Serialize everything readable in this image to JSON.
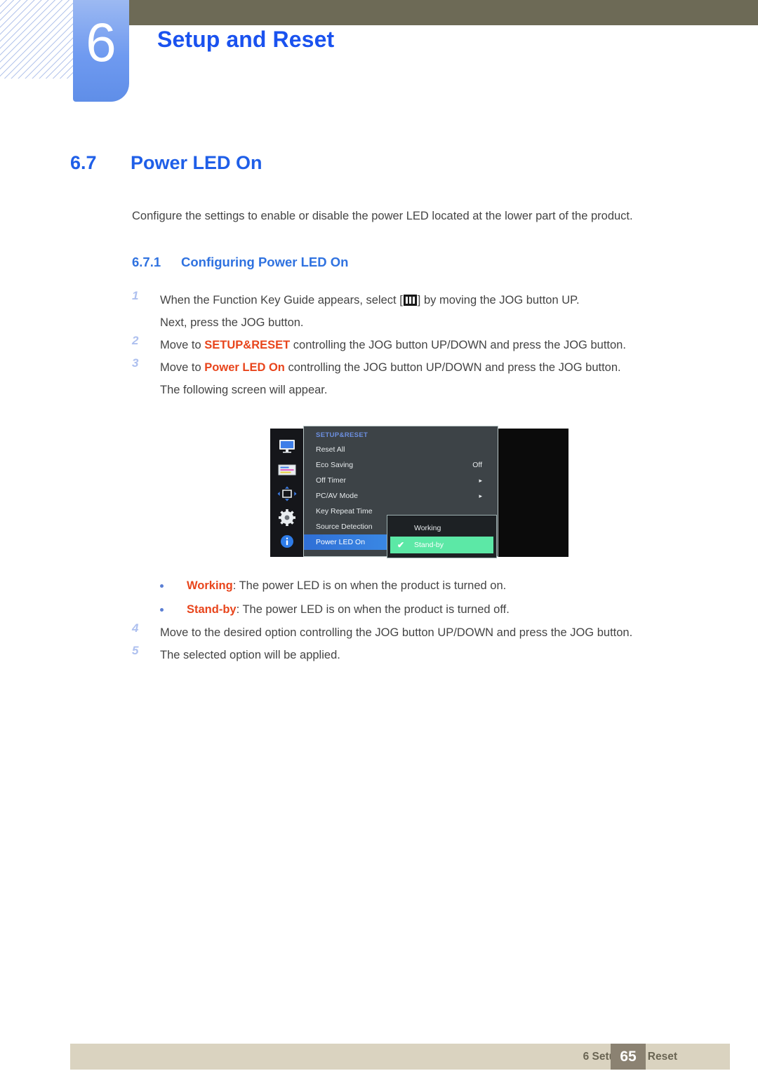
{
  "chapter": {
    "number": "6",
    "title": "Setup and Reset"
  },
  "section": {
    "number": "6.7",
    "title": "Power LED On",
    "intro": "Configure the settings to enable or disable the power LED located at the lower part of the product."
  },
  "subsection": {
    "number": "6.7.1",
    "title": "Configuring Power LED On"
  },
  "steps": [
    {
      "num": "1",
      "pre": "When the Function Key Guide appears, select [",
      "post": "] by moving the JOG button UP.",
      "line2": "Next, press the JOG button.",
      "icon": "osd-menu-icon"
    },
    {
      "num": "2",
      "pre": "Move to ",
      "highlight": "SETUP&RESET",
      "post": " controlling the JOG button UP/DOWN and press the JOG button."
    },
    {
      "num": "3",
      "pre": "Move to ",
      "highlight": "Power LED On",
      "post": " controlling the JOG button UP/DOWN and press the JOG button.",
      "line2": "The following screen will appear."
    }
  ],
  "steps_after": [
    {
      "num": "4",
      "text": "Move to the desired option controlling the JOG button UP/DOWN and press the JOG button."
    },
    {
      "num": "5",
      "text": "The selected option will be applied."
    }
  ],
  "osd": {
    "heading": "SETUP&RESET",
    "rail_icons": [
      "monitor-icon",
      "picture-settings-icon",
      "screen-adjust-icon",
      "gear-icon",
      "info-icon"
    ],
    "rows": [
      {
        "label": "Reset All",
        "value": "",
        "arrow": ""
      },
      {
        "label": "Eco Saving",
        "value": "Off",
        "arrow": ""
      },
      {
        "label": "Off Timer",
        "value": "",
        "arrow": "▸"
      },
      {
        "label": "PC/AV Mode",
        "value": "",
        "arrow": "▸"
      },
      {
        "label": "Key Repeat Time",
        "value": "",
        "arrow": ""
      },
      {
        "label": "Source Detection",
        "value": "",
        "arrow": ""
      },
      {
        "label": "Power LED On",
        "value": "",
        "arrow": "",
        "selected": true
      }
    ],
    "submenu": [
      {
        "label": "Working",
        "checked": false
      },
      {
        "label": "Stand-by",
        "checked": true,
        "check": "✔"
      }
    ],
    "colors": {
      "panel_bg": "#3d4347",
      "selected_blue": "#3d8fe8",
      "active_green": "#5ce8a6",
      "heading_blue": "#6c8fe0"
    }
  },
  "bullets": [
    {
      "term": "Working",
      "text": ": The power LED is on when the product is turned on."
    },
    {
      "term": "Stand-by",
      "text": ": The power LED is on when the product is turned off."
    }
  ],
  "footer": {
    "text": "6 Setup and Reset",
    "page": "65"
  }
}
